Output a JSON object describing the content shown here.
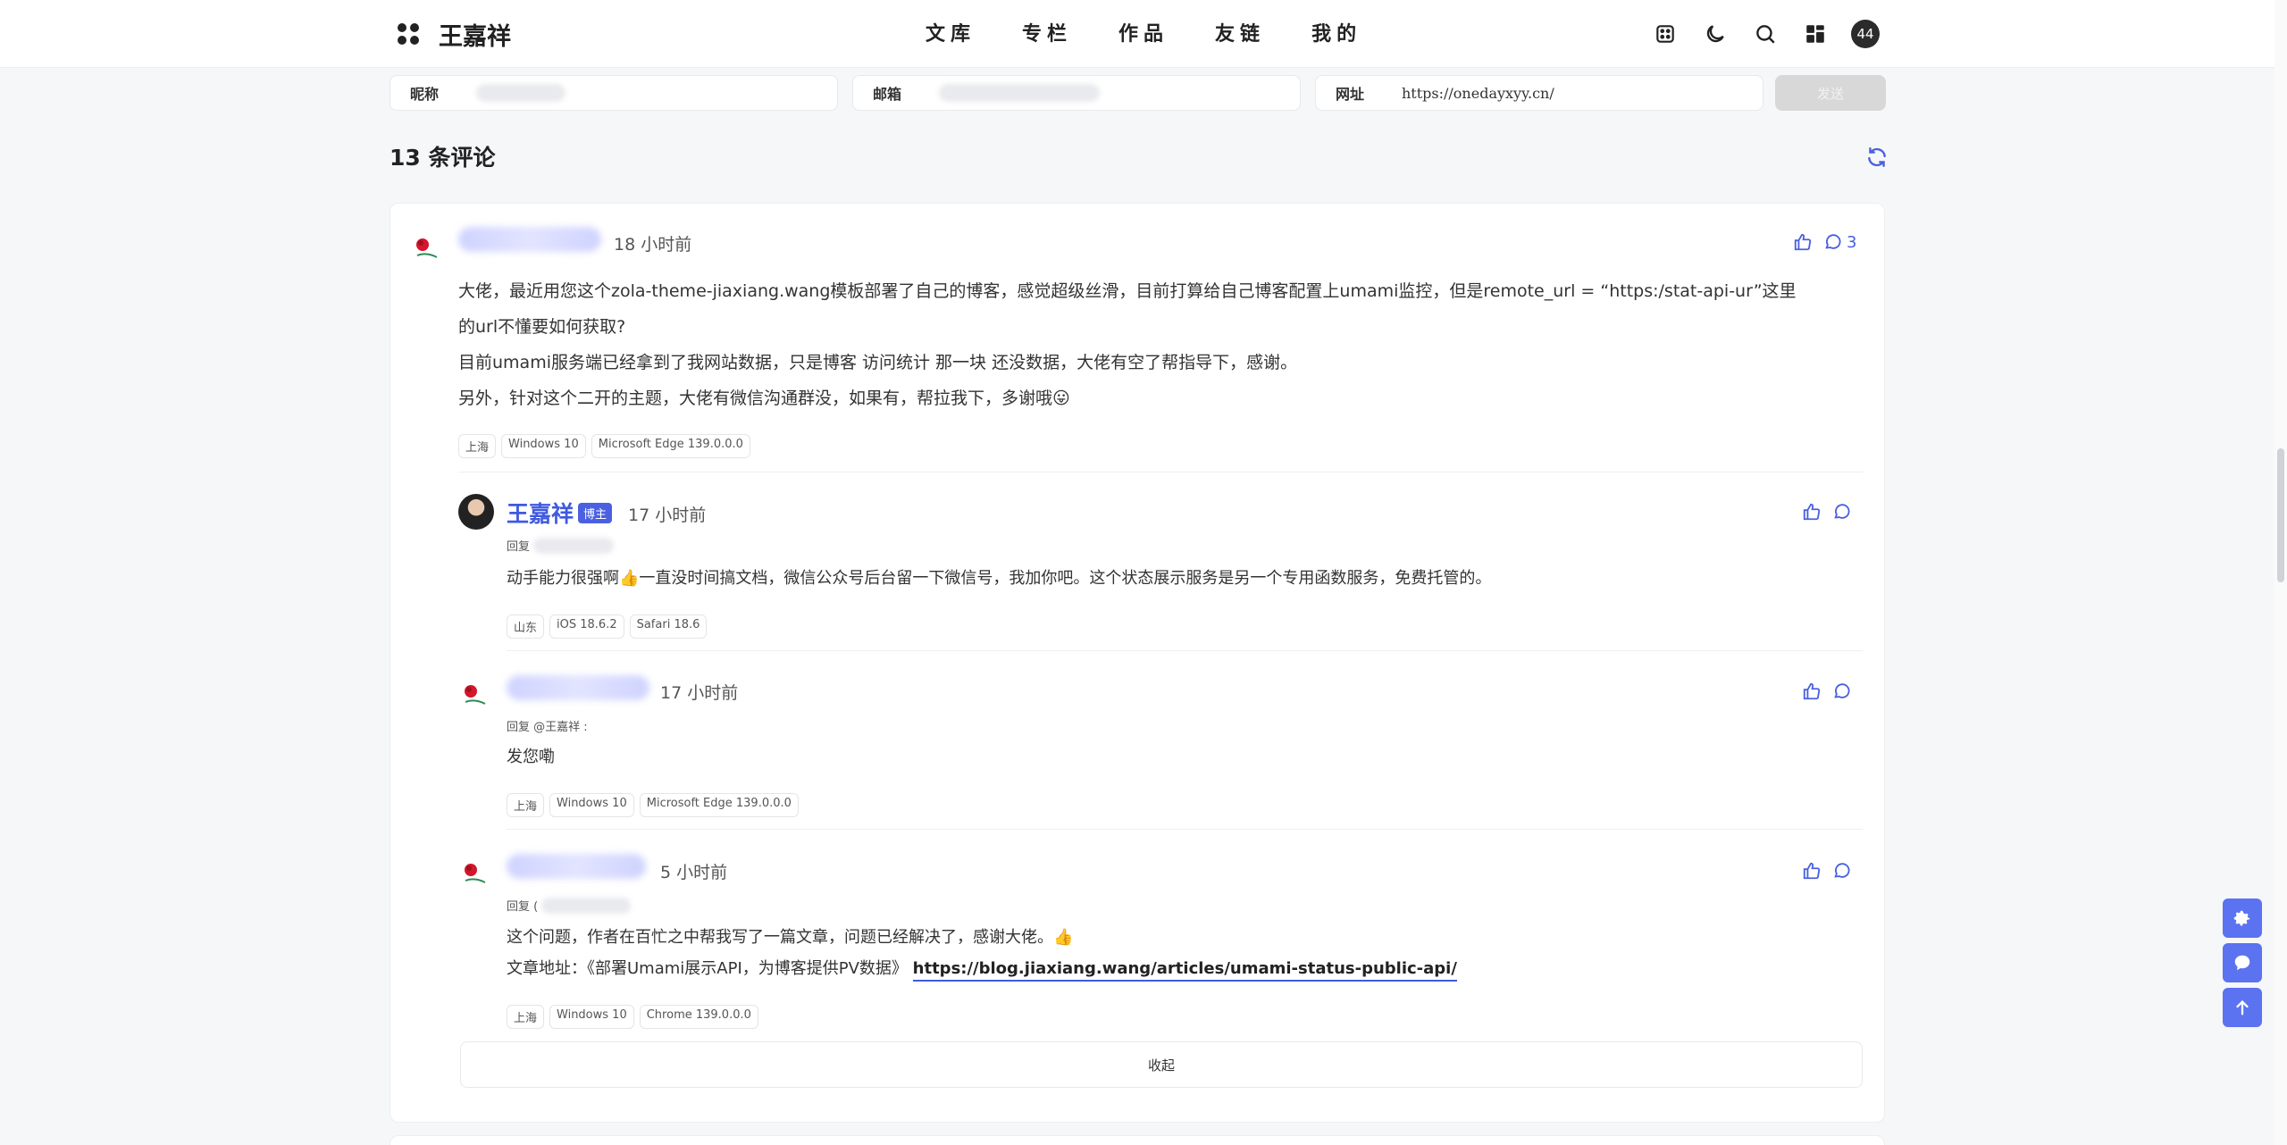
{
  "header": {
    "site_name": "王嘉祥",
    "nav": [
      "文库",
      "专栏",
      "作品",
      "友链",
      "我的"
    ],
    "avatar_text": "44"
  },
  "form": {
    "nickname_label": "昵称",
    "email_label": "邮箱",
    "url_label": "网址",
    "url_value": "https://onedayxyy.cn/",
    "submit_label": "发送"
  },
  "comments_title": "13 条评论",
  "main_comment": {
    "time": "18 小时前",
    "reply_count": "3",
    "lines": [
      "大佬，最近用您这个zola-theme-jiaxiang.wang模板部署了自己的博客，感觉超级丝滑，目前打算给自己博客配置上umami监控，但是remote_url = “https:/stat-api-ur”这里",
      "的url不懂要如何获取?",
      "目前umami服务端已经拿到了我网站数据，只是博客 访问统计 那一块 还没数据，大佬有空了帮指导下，感谢。",
      "另外，针对这个二开的主题，大佬有微信沟通群没，如果有，帮拉我下，多谢哦😛"
    ],
    "tags": [
      "上海",
      "Windows 10",
      "Microsoft Edge 139.0.0.0"
    ]
  },
  "replies": [
    {
      "author": "王嘉祥",
      "badge": "博主",
      "time": "17 小时前",
      "reply_prefix": "回复",
      "text": "动手能力很强啊👍一直没时间搞文档，微信公众号后台留一下微信号，我加你吧。这个状态展示服务是另一个专用函数服务，免费托管的。",
      "tags": [
        "山东",
        "iOS 18.6.2",
        "Safari 18.6"
      ]
    },
    {
      "time": "17 小时前",
      "reply_prefix": "回复 @王嘉祥 :",
      "text": "发您嘞",
      "tags": [
        "上海",
        "Windows 10",
        "Microsoft Edge 139.0.0.0"
      ]
    },
    {
      "time": "5 小时前",
      "reply_prefix": "回复 (",
      "text": "这个问题，作者在百忙之中帮我写了一篇文章，问题已经解决了，感谢大佬。👍",
      "text2_prefix": "文章地址：《部署Umami展示API，为博客提供PV数据》",
      "link": "https://blog.jiaxiang.wang/articles/umami-status-public-api/",
      "tags": [
        "上海",
        "Windows 10",
        "Chrome 139.0.0.0"
      ]
    }
  ],
  "collapse_label": "收起",
  "colors": {
    "accent": "#4a60e0",
    "side_button": "#5b73f0"
  }
}
